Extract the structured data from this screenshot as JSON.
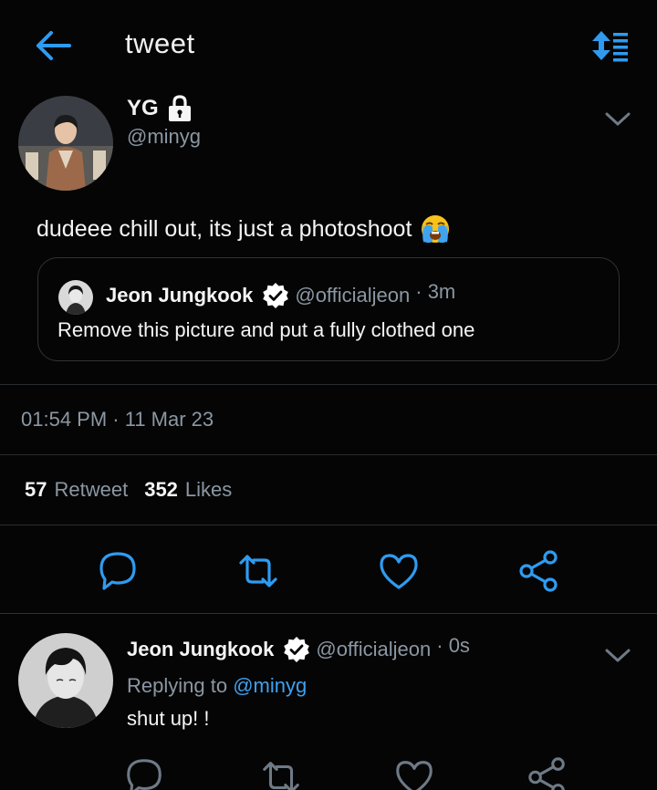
{
  "header": {
    "title": "tweet",
    "accent_color": "#2f9bf0",
    "back_icon": "arrow-left-icon",
    "sort_icon": "sort-list-icon"
  },
  "tweet": {
    "author_name": "YG",
    "author_handle": "@minyg",
    "locked": true,
    "text": "dudeee chill out,  its just a photoshoot",
    "emoji": "loudly-crying-face",
    "quote": {
      "author_name": "Jeon Jungkook",
      "author_handle": "@officialjeon",
      "time": "· 3m",
      "verified": true,
      "text": "Remove this picture and put a fully clothed one"
    },
    "timestamp": "01:54 PM · 11 Mar 23",
    "stats": {
      "retweets": "57",
      "retweets_label": "Retweet",
      "likes": "352",
      "likes_label": "Likes"
    }
  },
  "reply": {
    "author_name": "Jeon Jungkook",
    "author_handle": "@officialjeon",
    "time": "· 0s",
    "verified": true,
    "replying_prefix": "Replying to",
    "replying_to": "@minyg",
    "text": "shut up! !"
  },
  "actions": [
    "reply-icon",
    "retweet-icon",
    "like-icon",
    "share-icon"
  ]
}
